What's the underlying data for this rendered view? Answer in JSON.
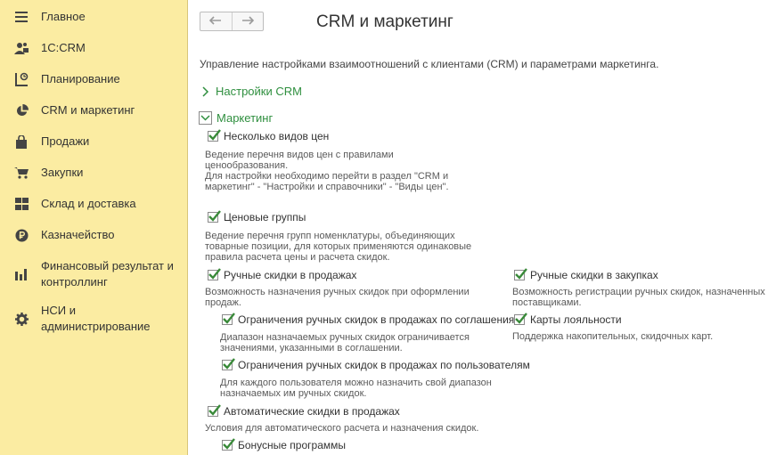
{
  "sidebar": {
    "items": [
      {
        "label": "Главное",
        "icon": "hamburger-menu-icon"
      },
      {
        "label": "1С:CRM",
        "icon": "user-group-icon"
      },
      {
        "label": "Планирование",
        "icon": "planning-chart-icon"
      },
      {
        "label": "CRM и маркетинг",
        "icon": "pie-chart-icon"
      },
      {
        "label": "Продажи",
        "icon": "shopping-bag-icon"
      },
      {
        "label": "Закупки",
        "icon": "shopping-cart-icon"
      },
      {
        "label": "Склад и доставка",
        "icon": "grid-warehouse-icon"
      },
      {
        "label": "Казначейство",
        "icon": "ruble-coin-icon"
      },
      {
        "label": "Финансовый результат и контроллинг",
        "icon": "bar-chart-icon"
      },
      {
        "label": "НСИ и администрирование",
        "icon": "gear-icon"
      }
    ]
  },
  "header": {
    "title": "CRM и маркетинг",
    "back_icon": "arrow-left-icon",
    "forward_icon": "arrow-right-icon"
  },
  "main": {
    "description": "Управление настройками взаимоотношений с клиентами (CRM) и параметрами маркетинга.",
    "crm_settings_group": "Настройки CRM",
    "marketing_group": "Маркетинг",
    "options": {
      "multi_price": {
        "label": "Несколько видов цен",
        "checked": true,
        "hint": [
          "Ведение перечня видов цен с правилами",
          "ценообразования.",
          "Для настройки необходимо перейти в раздел \"CRM и",
          "маркетинг\" - \"Настройки и справочники\" - \"Виды цен\"."
        ]
      },
      "price_groups": {
        "label": "Ценовые группы",
        "checked": true,
        "hint": [
          "Ведение перечня групп номенклатуры, объединяющих",
          "товарные позиции, для которых применяются одинаковые",
          "правила расчета цены и расчета скидок."
        ]
      },
      "manual_discounts_sales": {
        "label": "Ручные скидки в продажах",
        "checked": true,
        "hint": [
          "Возможность назначения ручных скидок при оформлении",
          "продаж."
        ]
      },
      "manual_discounts_purchases": {
        "label": "Ручные скидки в закупках",
        "checked": true,
        "hint": [
          "Возможность регистрации ручных скидок, назначенных",
          "поставщиками."
        ]
      },
      "limit_by_agreements": {
        "label": "Ограничения ручных скидок в продажах по соглашениям",
        "checked": true,
        "hint": [
          "Диапазон назначаемых ручных скидок ограничивается",
          "значениями, указанными в соглашении."
        ]
      },
      "loyalty_cards": {
        "label": "Карты лояльности",
        "checked": true,
        "hint": [
          "Поддержка накопительных, скидочных карт."
        ]
      },
      "limit_by_users": {
        "label": "Ограничения ручных скидок в продажах по пользователям",
        "checked": true,
        "hint": [
          "Для каждого пользователя можно назначить свой диапазон",
          "назначаемых им ручных скидок."
        ]
      },
      "auto_discounts": {
        "label": "Автоматические скидки в продажах",
        "checked": true,
        "hint": [
          "Условия для автоматического расчета и назначения скидок."
        ]
      },
      "bonus_programs": {
        "label": "Бонусные программы",
        "checked": true
      }
    }
  },
  "colors": {
    "sidebar_bg": "#fbeca2",
    "link_green": "#2f8f3f",
    "check_green": "#3a8a3a"
  }
}
